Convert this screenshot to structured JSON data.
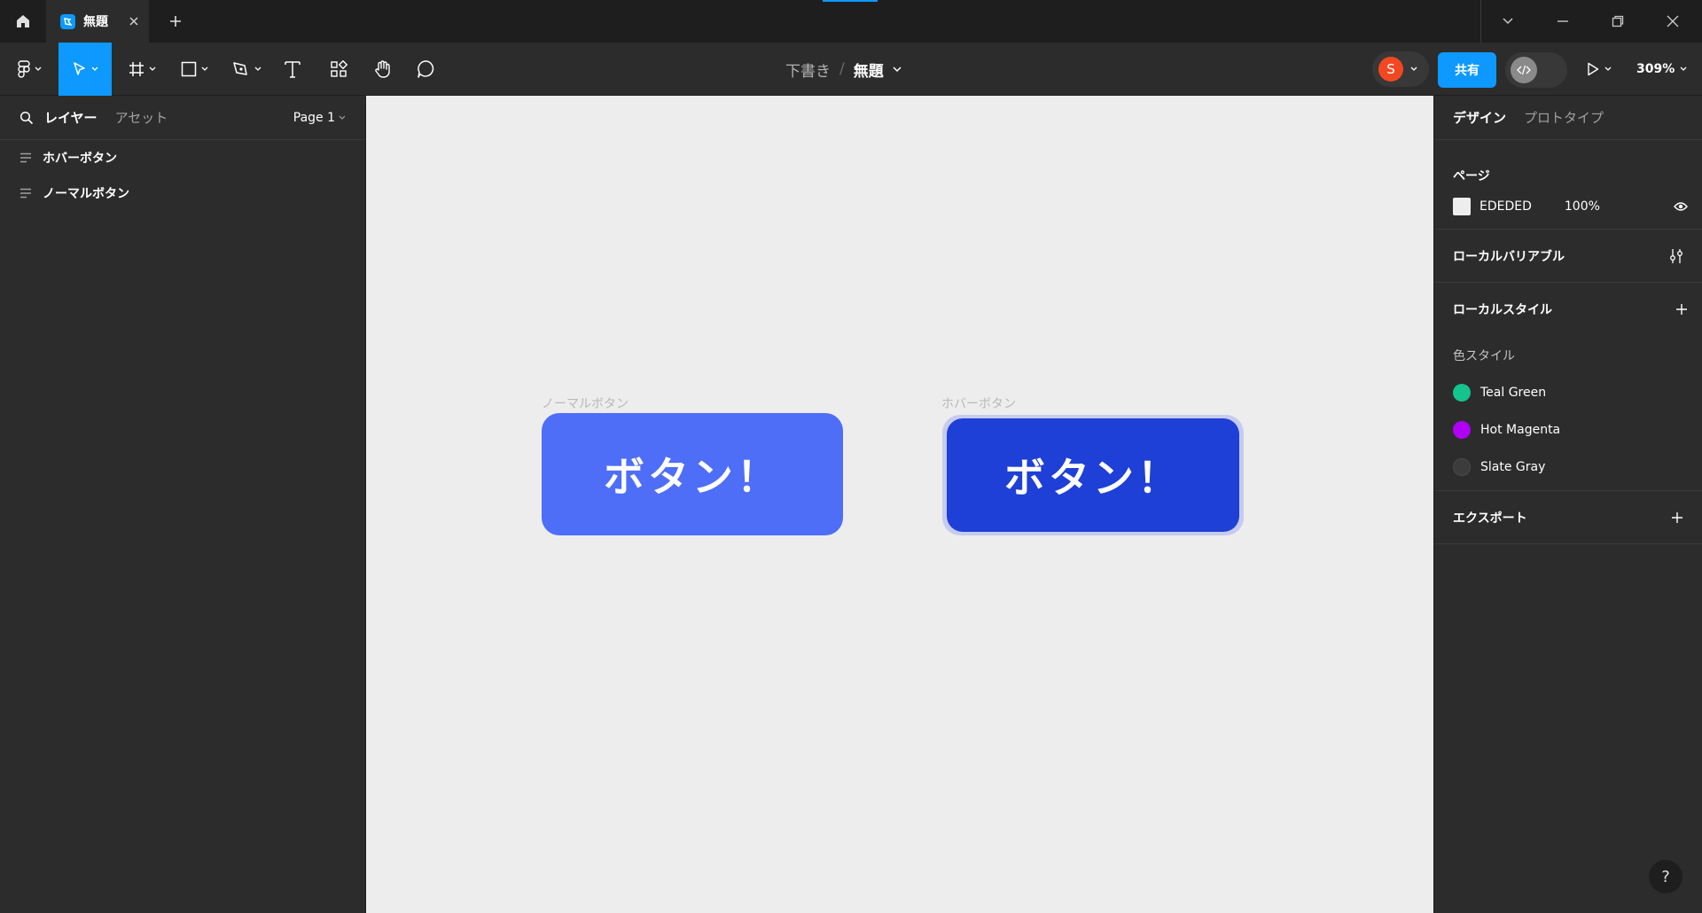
{
  "titlebar": {
    "tab_title": "無題"
  },
  "toolbar": {
    "breadcrumb_draft": "下書き",
    "breadcrumb_sep": "/",
    "breadcrumb_file": "無題",
    "avatar_initial": "S",
    "share_label": "共有",
    "zoom": "309%"
  },
  "left_panel": {
    "tab_layers": "レイヤー",
    "tab_assets": "アセット",
    "page_selector": "Page 1",
    "layers": [
      {
        "name": "ホバーボタン"
      },
      {
        "name": "ノーマルボタン"
      }
    ]
  },
  "canvas": {
    "background": "#EDEDED",
    "frames": [
      {
        "label": "ノーマルボタン",
        "button_text": "ボタン！",
        "fill": "#4F6EF7"
      },
      {
        "label": "ホバーボタン",
        "button_text": "ボタン！",
        "fill": "#1F40D6"
      }
    ]
  },
  "right_panel": {
    "tab_design": "デザイン",
    "tab_prototype": "プロトタイプ",
    "page_section_title": "ページ",
    "page_color_hex": "EDEDED",
    "page_opacity": "100%",
    "local_variables_title": "ローカルバリアブル",
    "local_styles_title": "ローカルスタイル",
    "color_styles_label": "色スタイル",
    "color_styles": [
      {
        "name": "Teal Green",
        "color": "#14C38E"
      },
      {
        "name": "Hot Magenta",
        "color": "#B000F5"
      },
      {
        "name": "Slate Gray",
        "color": "#3C3C3C"
      }
    ],
    "export_title": "エクスポート"
  },
  "help_label": "?"
}
